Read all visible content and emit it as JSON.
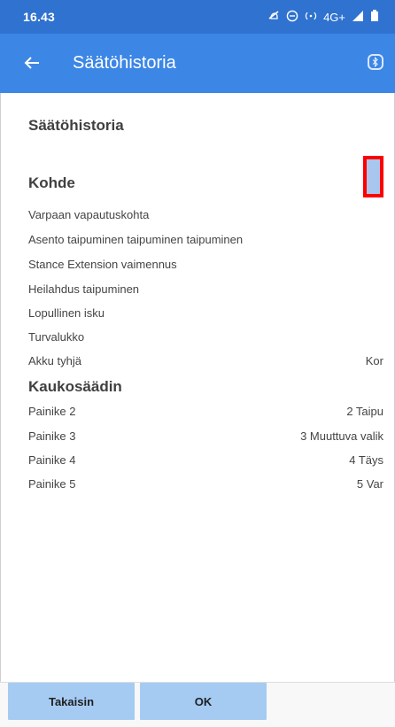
{
  "status_bar": {
    "time": "16.43",
    "network": "4G+"
  },
  "app_bar": {
    "title": "Säätöhistoria",
    "back_icon": "arrow-left-icon",
    "bluetooth_icon": "bluetooth-icon"
  },
  "content": {
    "page_title": "Säätöhistoria",
    "section1_title": "Kohde",
    "kohde_items": [
      {
        "label": "Varpaan vapautuskohta",
        "value": ""
      },
      {
        "label": "Asento taipuminen taipuminen taipuminen",
        "value": ""
      },
      {
        "label": "Stance Extension vaimennus",
        "value": ""
      },
      {
        "label": "Heilahdus taipuminen",
        "value": ""
      },
      {
        "label": "Lopullinen isku",
        "value": ""
      },
      {
        "label": "Turvalukko",
        "value": ""
      },
      {
        "label": "Akku tyhjä",
        "value": "Kor"
      }
    ],
    "section2_title": "Kaukosäädin",
    "kaukosaadin_items": [
      {
        "label": "Painike 2",
        "value": "2 Taipu"
      },
      {
        "label": "Painike 3",
        "value": "3 Muuttuva valik"
      },
      {
        "label": "Painike 4",
        "value": "4 Täys"
      },
      {
        "label": "Painike 5",
        "value": "5 Var"
      }
    ]
  },
  "buttons": {
    "back_label": "Takaisin",
    "ok_label": "OK"
  },
  "colors": {
    "status_bar": "#2f72cf",
    "app_bar": "#3c86e6",
    "button": "#a5cbf3",
    "highlight": "#ff0000"
  }
}
